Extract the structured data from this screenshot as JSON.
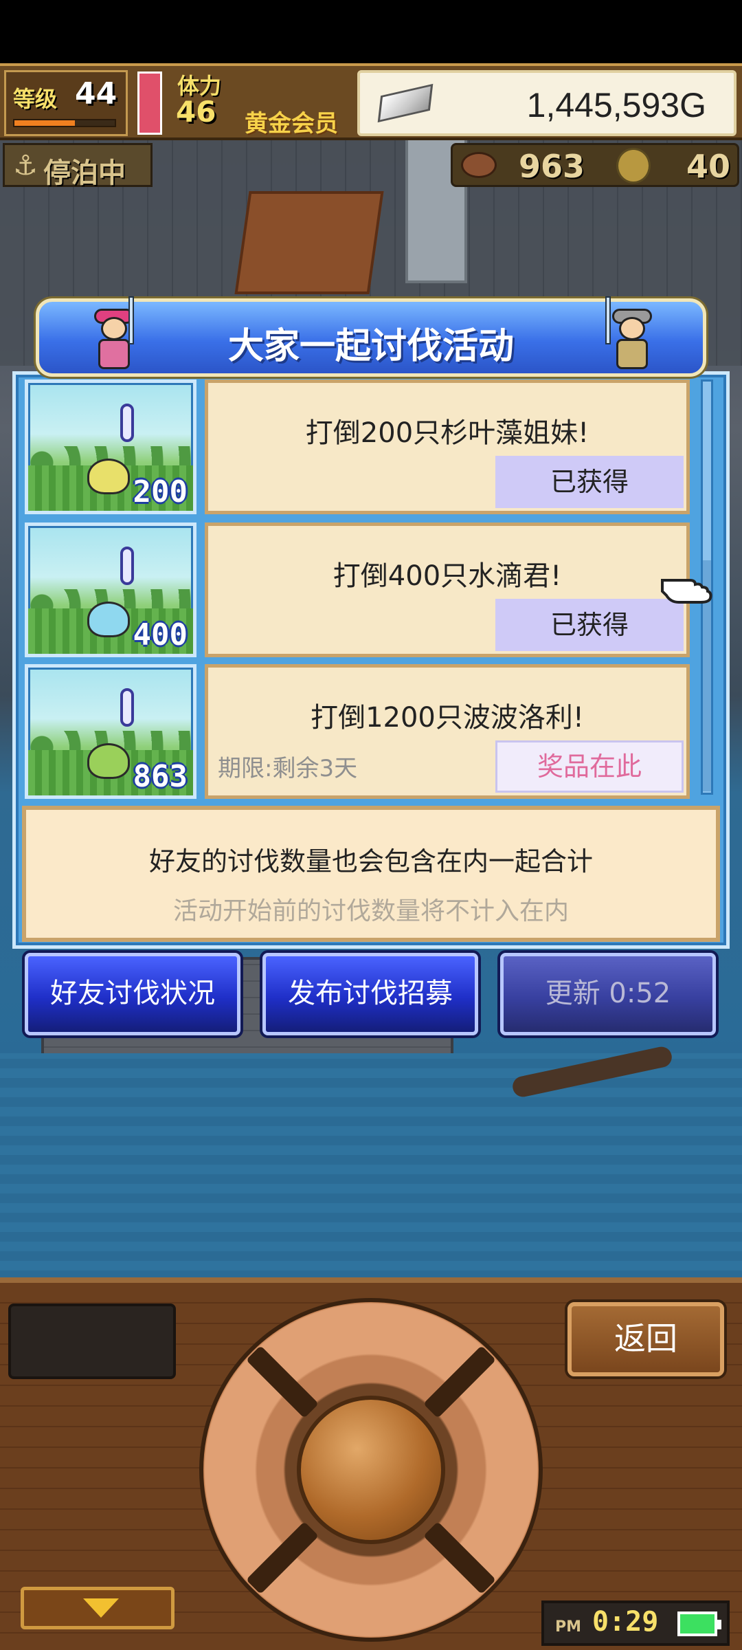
{
  "hud": {
    "level_label": "等级",
    "level_value": "44",
    "level_bar_fraction": 0.6,
    "stamina_label": "体力",
    "stamina_value": "46",
    "stamina_gauge_fraction": 1.0,
    "membership": "黄金会员",
    "gold": "1,445,593G",
    "status_label": "停泊中",
    "resource1_icon": "meat-icon",
    "resource1_value": "963",
    "resource2_icon": "medal-icon",
    "resource2_value": "40"
  },
  "event": {
    "title": "大家一起讨伐活动",
    "tasks": [
      {
        "count": "200",
        "title": "打倒200只杉叶藻姐妹!",
        "status": "已获得",
        "deadline": "",
        "monster_color": "#e8e06a"
      },
      {
        "count": "400",
        "title": "打倒400只水滴君!",
        "status": "已获得",
        "deadline": "",
        "monster_color": "#8fd8ef"
      },
      {
        "count": "863",
        "title": "打倒1200只波波洛利!",
        "status": "奖品在此",
        "deadline": "期限:剩余3天",
        "monster_color": "#9ad05a"
      }
    ],
    "note_main": "好友的讨伐数量也会包含在内一起合计",
    "note_sub": "活动开始前的讨伐数量将不计入在内"
  },
  "buttons": {
    "friends_status": "好友讨伐状况",
    "publish_recruit": "发布讨伐招募",
    "refresh": "更新 0:52"
  },
  "controls": {
    "back": "返回",
    "clock_ampm": "PM",
    "clock_time": "0:29",
    "battery_fraction": 1.0
  },
  "colors": {
    "title_bar": "#3a70e8",
    "panel": "#4fa3e0",
    "button": "#1f2fc8",
    "claim_text": "#e06a9c"
  }
}
